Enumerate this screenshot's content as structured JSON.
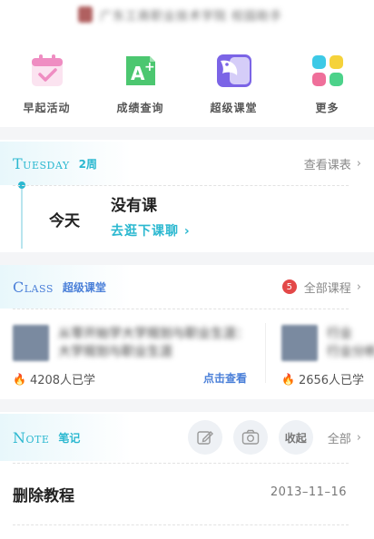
{
  "top": {
    "title_blurred": "广东工商职业技术学院 校园助手"
  },
  "quick_actions": [
    {
      "label": "早起活动",
      "icon": "calendar-check-icon",
      "color": "#ee8fc0"
    },
    {
      "label": "成绩查询",
      "icon": "grade-a-plus-icon",
      "color": "#4cc770"
    },
    {
      "label": "超级课堂",
      "icon": "bird-book-icon",
      "color": "#7b64e6"
    },
    {
      "label": "更多",
      "icon": "grid-dots-icon",
      "color": "#3dc9e6"
    }
  ],
  "schedule": {
    "en": "Tuesday",
    "cn": "2周",
    "action": "查看课表",
    "today_label": "今天",
    "no_class": "没有课",
    "go_link": "去逛下课聊"
  },
  "class_section": {
    "en": "Class",
    "cn": "超级课堂",
    "badge_count": "5",
    "action": "全部课程",
    "courses": [
      {
        "title_line1": "从零开始学大学规划与职业生涯：",
        "title_line2": "大学规划与职业生涯",
        "learners": "4208人已学",
        "view": "点击查看"
      },
      {
        "title_line1": "行业",
        "title_line2": "行业分析",
        "learners": "2656人已学",
        "view": ""
      }
    ]
  },
  "note_section": {
    "en": "Note",
    "cn": "笔记",
    "collapse": "收起",
    "all": "全部",
    "items": [
      {
        "title": "删除教程",
        "date": "2013–11–16"
      }
    ]
  }
}
